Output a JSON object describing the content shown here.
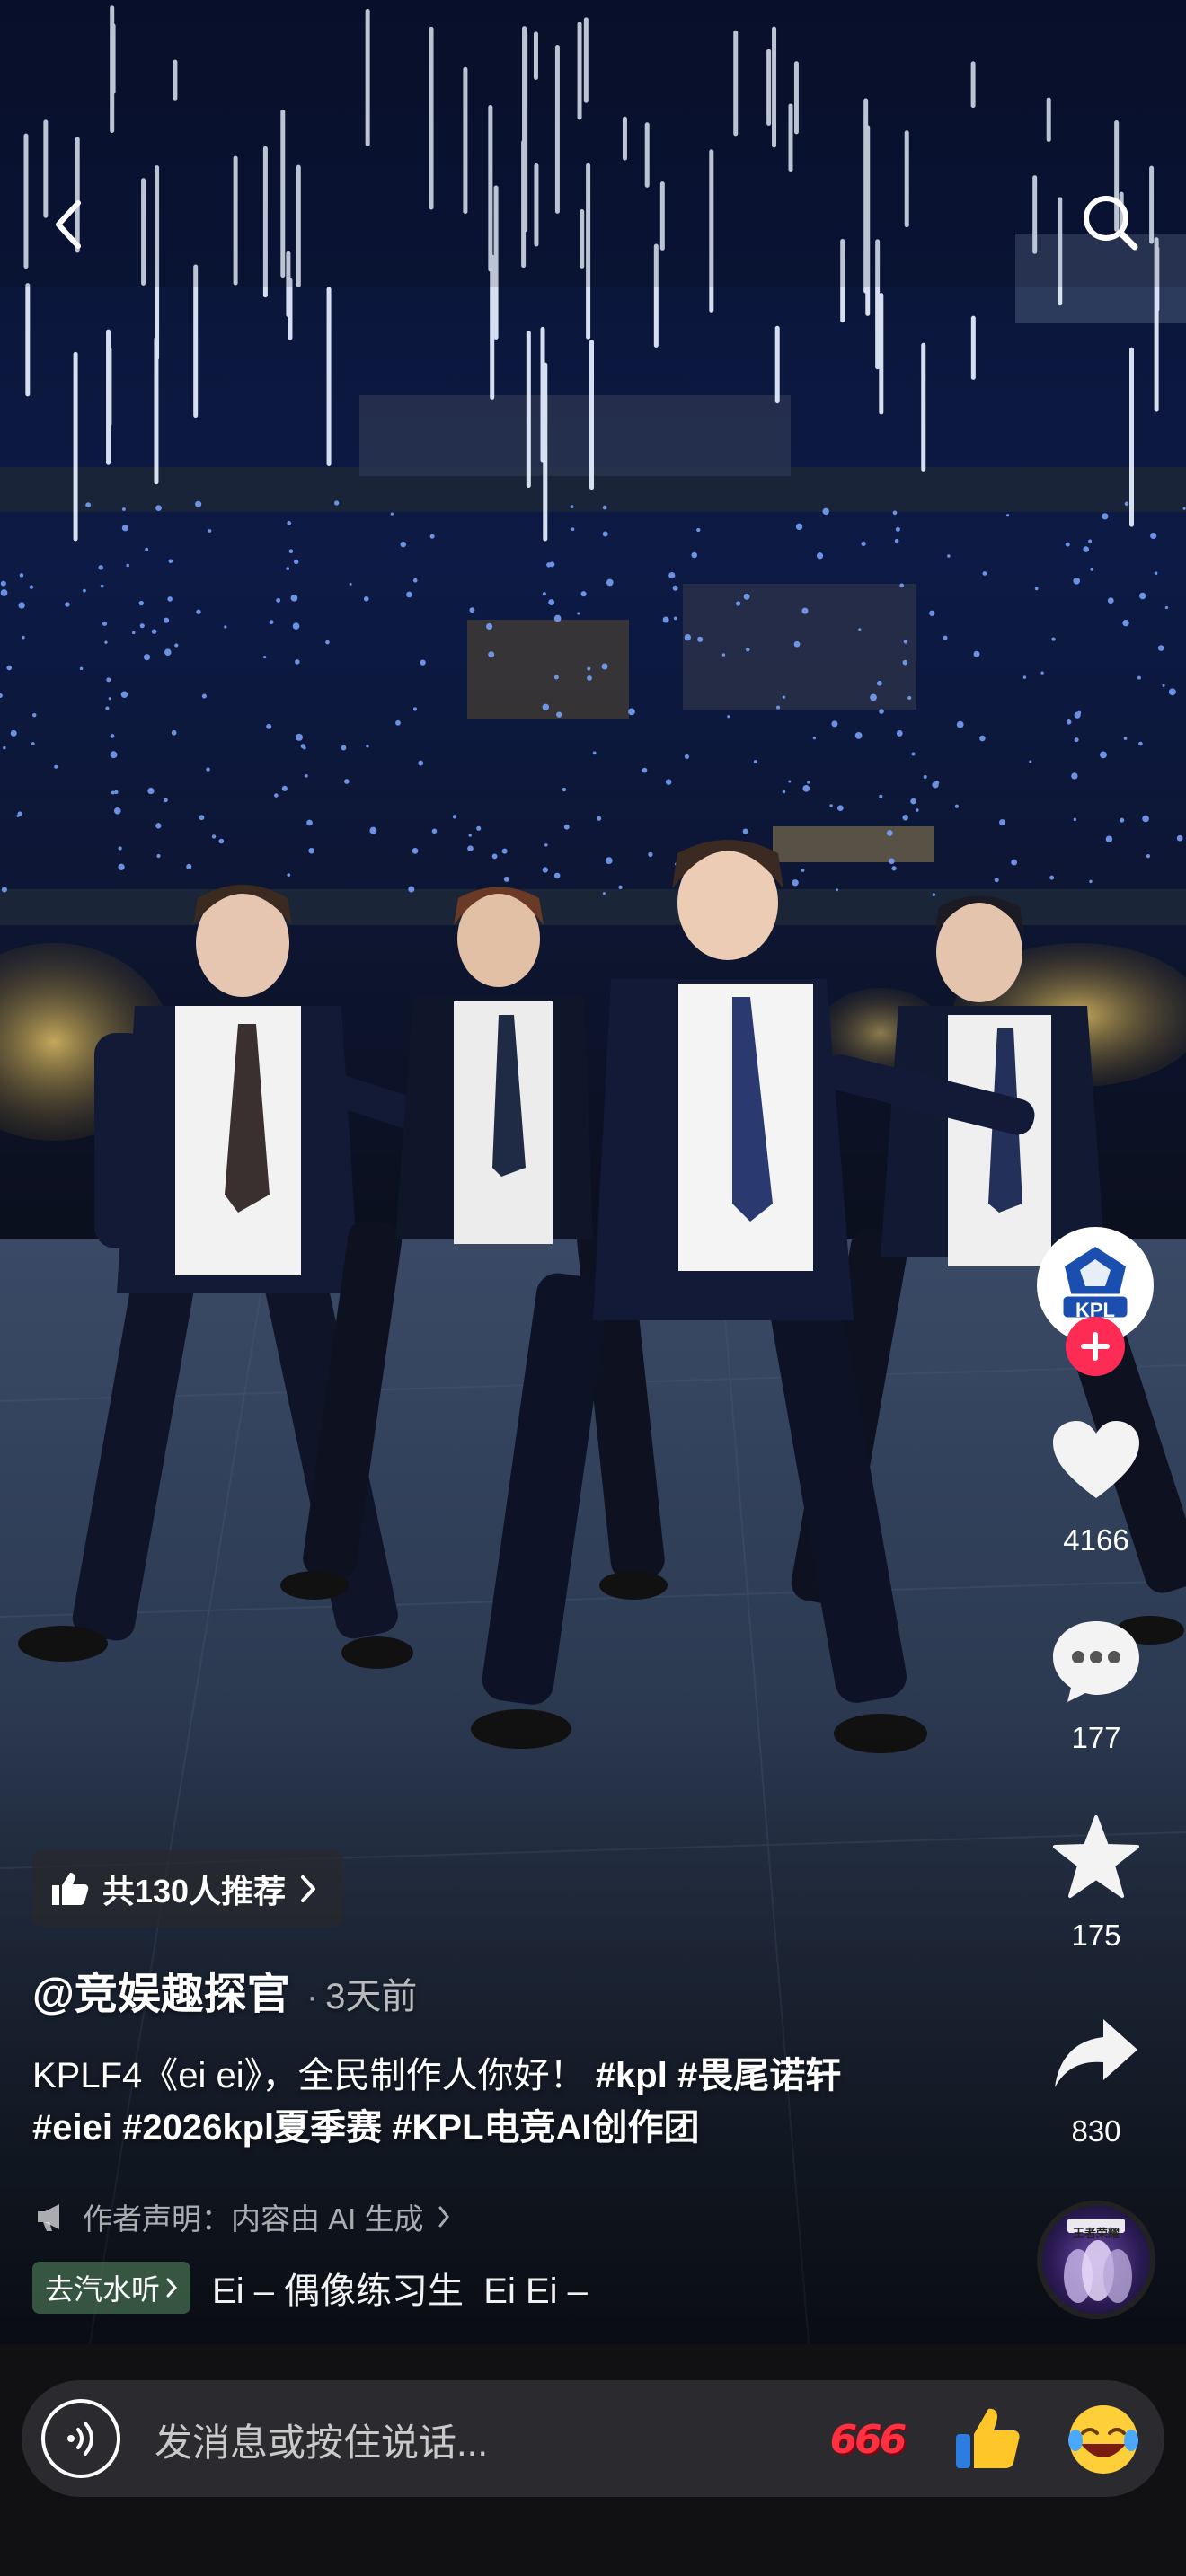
{
  "header": {
    "back_icon": "chevron-left-icon",
    "search_icon": "search-icon"
  },
  "creator": {
    "avatar_text": "KPL",
    "follow_icon": "plus-icon"
  },
  "actions": {
    "likes": "4166",
    "comments": "177",
    "favorites": "175",
    "shares": "830"
  },
  "recommend": {
    "label": "共130人推荐"
  },
  "post": {
    "author": "@竞娱趣探官",
    "separator": "·",
    "time": "3天前",
    "caption_text": "KPLF4《ei ei》，全民制作人你好！",
    "hashtags": [
      "#kpl",
      "#畏尾诺轩",
      "#eiei",
      "#2026kpl夏季赛",
      "#KPL电竞AI创作团"
    ],
    "ai_notice": "作者声明：内容由 AI 生成"
  },
  "music": {
    "button_label": "去汽水听",
    "title": "Ei – 偶像练习生  Ei Ei –",
    "disc_label": "王者荣耀"
  },
  "comment_bar": {
    "placeholder": "发消息或按住说话...",
    "quick_emoji_1": "666",
    "quick_emoji_2": "👍",
    "quick_emoji_3": "😂"
  },
  "colors": {
    "follow_red": "#fe2c55",
    "kpl_blue": "#1a4fb0",
    "bar_bg": "#111114"
  }
}
